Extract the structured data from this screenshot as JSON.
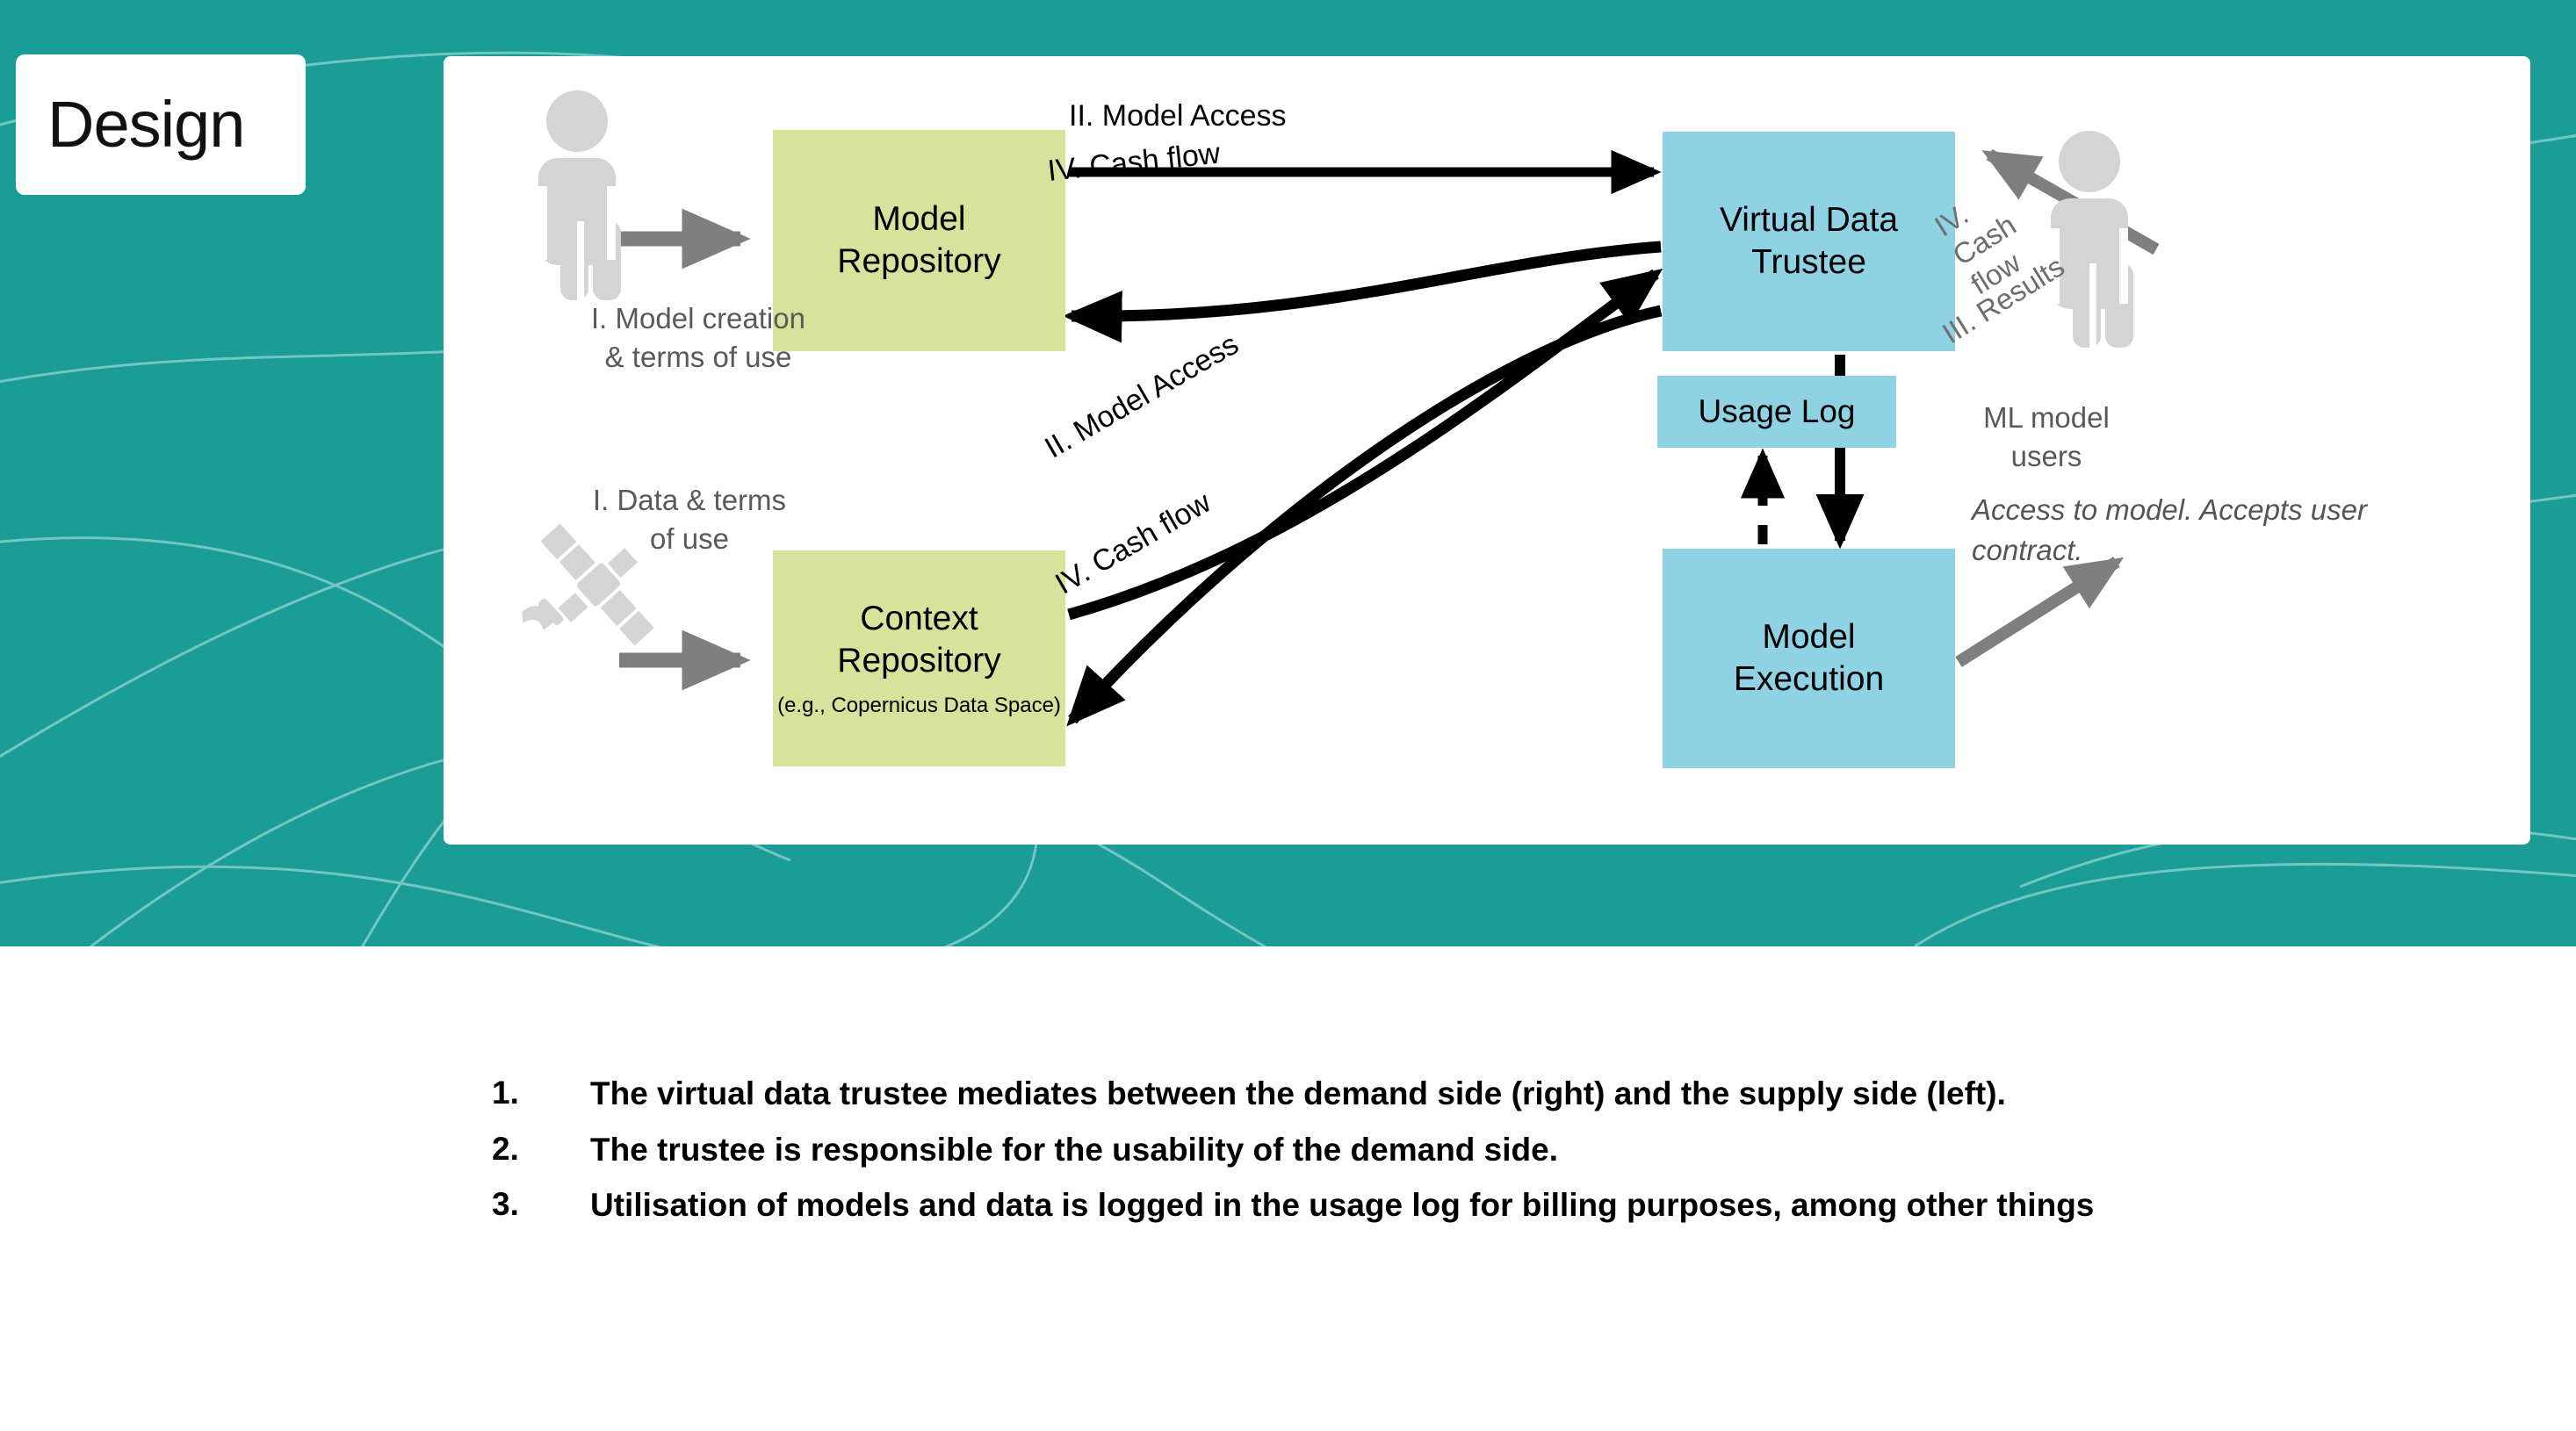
{
  "slide": {
    "title": "Design",
    "colors": {
      "banner_teal": "#1c9c96",
      "card_white": "#ffffff",
      "repo_green": "#d7e29b",
      "trustee_blue": "#8fd2e4",
      "grey_icon": "#d4d4d4",
      "grey_arrow": "#7f7f7f",
      "caption_grey": "#595959"
    }
  },
  "diagram": {
    "boxes": {
      "model_repository": {
        "label": "Model\nRepository",
        "line1": "Model",
        "line2": "Repository"
      },
      "context_repository": {
        "line1": "Context",
        "line2": "Repository",
        "sub": "(e.g., Copernicus Data Space)"
      },
      "virtual_data_trustee": {
        "line1": "Virtual Data",
        "line2": "Trustee"
      },
      "usage_log": {
        "label": "Usage Log"
      },
      "model_execution": {
        "line1": "Model",
        "line2": "Execution"
      }
    },
    "captions": {
      "model_creation": "I. Model creation & terms of use",
      "data_terms": "I. Data & terms of use",
      "ml_model_users": "ML model users",
      "access_note": "Access to model. Accepts user contract."
    },
    "arrow_labels": {
      "model_access_top": "II. Model Access",
      "cash_flow_top": "IV. Cash flow",
      "model_access_mid": "II. Model Access",
      "cash_flow_mid": "IV. Cash flow",
      "cash_flow_right": "IV. Cash flow",
      "results_right": "III. Results"
    },
    "icons": {
      "supplier_person": "person-icon",
      "satellite": "satellite-icon",
      "consumer_person": "person-icon"
    }
  },
  "bullets": [
    {
      "num": "1.",
      "text": "The virtual data trustee mediates between the demand side (right) and the supply side (left)."
    },
    {
      "num": "2.",
      "text": "The trustee is responsible for the usability of the demand side."
    },
    {
      "num": "3.",
      "text": "Utilisation of models and data is logged in the usage log for billing purposes, among other things"
    }
  ]
}
